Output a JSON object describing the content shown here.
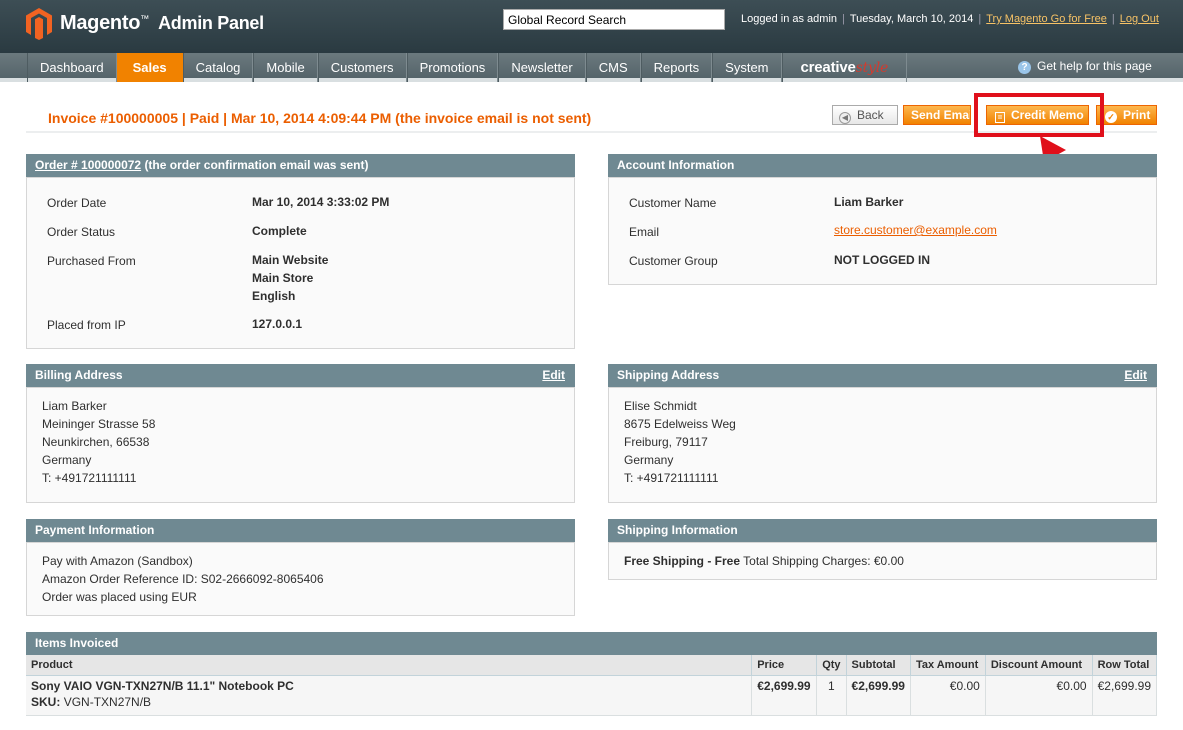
{
  "header": {
    "logo_name": "Magento",
    "logo_tm": "™",
    "logo_sub": "Admin Panel",
    "search_value": "Global Record Search",
    "logged_in": "Logged in as admin",
    "date": "Tuesday, March 10, 2014",
    "try_link": "Try Magento Go for Free",
    "logout": "Log Out"
  },
  "nav": {
    "items": [
      "Dashboard",
      "Sales",
      "Catalog",
      "Mobile",
      "Customers",
      "Promotions",
      "Newsletter",
      "CMS",
      "Reports",
      "System"
    ],
    "brand_a": "creative",
    "brand_b": "style",
    "help": "Get help for this page",
    "active": "Sales"
  },
  "page": {
    "title": "Invoice #100000005 | Paid | Mar 10, 2014 4:09:44 PM (the invoice email is not sent)"
  },
  "buttons": {
    "back": "Back",
    "send_email": "Send Email",
    "credit_memo": "Credit Memo",
    "print": "Print"
  },
  "order": {
    "head_link": "Order # 100000072",
    "head_rest": "(the order confirmation email was sent)",
    "labels": [
      "Order Date",
      "Order Status",
      "Purchased From",
      "Placed from IP"
    ],
    "order_date": "Mar 10, 2014 3:33:02 PM",
    "status": "Complete",
    "purchased_from": [
      "Main Website",
      "Main Store",
      "English"
    ],
    "ip": "127.0.0.1"
  },
  "account": {
    "head": "Account Information",
    "labels": [
      "Customer Name",
      "Email",
      "Customer Group"
    ],
    "name": "Liam Barker",
    "email": "store.customer@example.com",
    "group": "NOT LOGGED IN"
  },
  "billing": {
    "head": "Billing Address",
    "edit": "Edit",
    "lines": [
      "Liam Barker",
      "Meininger Strasse 58",
      "Neunkirchen, 66538",
      "Germany",
      "T: +491721111111"
    ]
  },
  "shipping": {
    "head": "Shipping Address",
    "edit": "Edit",
    "lines": [
      "Elise Schmidt",
      "8675 Edelweiss Weg",
      "Freiburg, 79117",
      "Germany",
      "T: +491721111111"
    ]
  },
  "payment": {
    "head": "Payment Information",
    "lines": [
      "Pay with Amazon (Sandbox)",
      "Amazon Order Reference ID: S02-2666092-8065406",
      "Order was placed using EUR"
    ]
  },
  "shipping_info": {
    "head": "Shipping Information",
    "method": "Free Shipping - Free",
    "charges": "Total Shipping Charges: €0.00"
  },
  "items": {
    "head": "Items Invoiced",
    "columns": [
      "Product",
      "Price",
      "Qty",
      "Subtotal",
      "Tax Amount",
      "Discount Amount",
      "Row Total"
    ],
    "rows": [
      {
        "product": "Sony VAIO VGN-TXN27N/B 11.1\" Notebook PC",
        "sku_label": "SKU:",
        "sku": "VGN-TXN27N/B",
        "price": "€2,699.99",
        "qty": "1",
        "subtotal": "€2,699.99",
        "tax": "€0.00",
        "discount": "€0.00",
        "row_total": "€2,699.99"
      }
    ]
  },
  "colors": {
    "accent": "#f18200",
    "title": "#eb5e00",
    "box_head": "#6f8992",
    "annotation_red": "#e0101b"
  }
}
